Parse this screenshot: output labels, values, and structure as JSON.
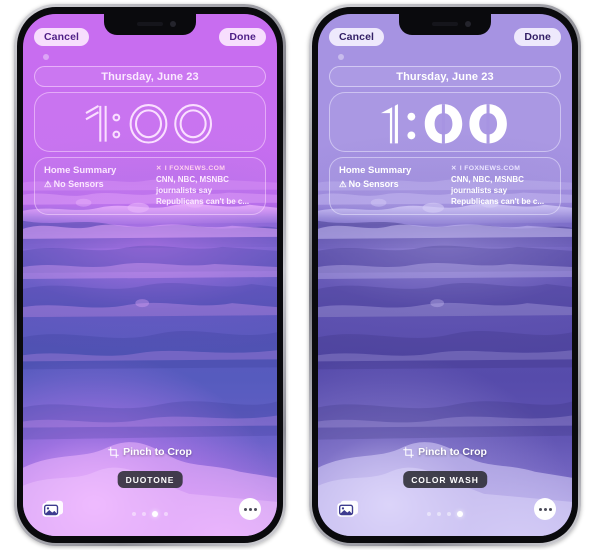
{
  "screens": [
    {
      "id": "duotone",
      "theme": "duotone",
      "topbar": {
        "cancel_label": "Cancel",
        "done_label": "Done"
      },
      "lock": {
        "date": "Thursday, June 23",
        "time": "1:00",
        "clock_style": "outline",
        "widgets": {
          "home": {
            "title": "Home Summary",
            "status_icon": "⚠",
            "status": "No Sensors"
          },
          "news": {
            "source_icon": "x-logo-icon",
            "source_mark": "✕",
            "source": "I FOXNEWS.COM",
            "headline_lines": [
              "CNN, NBC, MSNBC",
              "journalists say",
              "Republicans can't be c..."
            ]
          }
        }
      },
      "bottom": {
        "crop_hint": "Pinch to Crop",
        "crop_icon": "crop-icon",
        "style_label": "DUOTONE",
        "photo_icon": "photo-library-icon",
        "more_icon": "more-options-icon",
        "page_count": 4,
        "active_page": 3
      }
    },
    {
      "id": "colorwash",
      "theme": "colorwash",
      "topbar": {
        "cancel_label": "Cancel",
        "done_label": "Done"
      },
      "lock": {
        "date": "Thursday, June 23",
        "time": "1:00",
        "clock_style": "solid",
        "widgets": {
          "home": {
            "title": "Home Summary",
            "status_icon": "⚠",
            "status": "No Sensors"
          },
          "news": {
            "source_icon": "x-logo-icon",
            "source_mark": "✕",
            "source": "I FOXNEWS.COM",
            "headline_lines": [
              "CNN, NBC, MSNBC",
              "journalists say",
              "Republicans can't be c..."
            ]
          }
        }
      },
      "bottom": {
        "crop_hint": "Pinch to Crop",
        "crop_icon": "crop-icon",
        "style_label": "COLOR WASH",
        "photo_icon": "photo-library-icon",
        "more_icon": "more-options-icon",
        "page_count": 4,
        "active_page": 4
      }
    }
  ],
  "colors": {
    "duotone_highlight": "#c86ef0",
    "duotone_shadow": "#565bbe",
    "colorwash_highlight": "#a693e2",
    "colorwash_shadow": "#564bab",
    "label_bg": "#2c2c34",
    "pill_text_duotone": "#4e1f86",
    "pill_text_colorwash": "#332066"
  }
}
